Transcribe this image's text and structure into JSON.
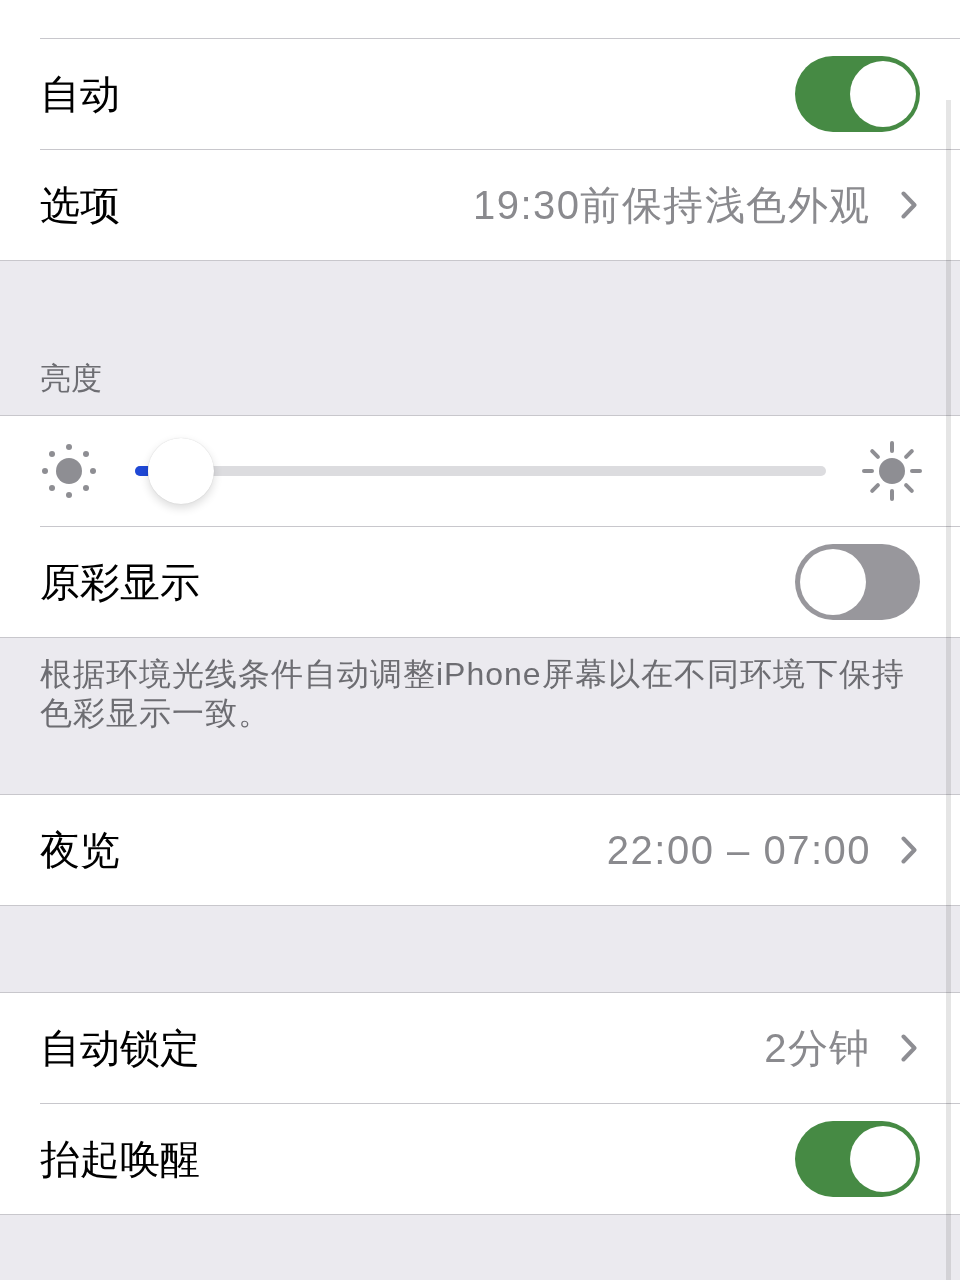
{
  "sections": [
    {
      "rows": [
        {
          "kind": "toggle",
          "label": "自动",
          "on": true
        },
        {
          "kind": "link",
          "label": "选项",
          "value": "19:30前保持浅色外观"
        }
      ]
    },
    {
      "header": "亮度",
      "rows": [
        {
          "kind": "slider",
          "level": 0.02
        },
        {
          "kind": "toggle",
          "label": "原彩显示",
          "on": false
        }
      ],
      "footer": "根据环境光线条件自动调整iPhone屏幕以在不同环境下保持色彩显示一致。"
    },
    {
      "rows": [
        {
          "kind": "link",
          "label": "夜览",
          "value": "22:00 – 07:00"
        }
      ]
    },
    {
      "rows": [
        {
          "kind": "link",
          "label": "自动锁定",
          "value": "2分钟"
        },
        {
          "kind": "toggle",
          "label": "抬起唤醒",
          "on": true
        }
      ]
    }
  ]
}
